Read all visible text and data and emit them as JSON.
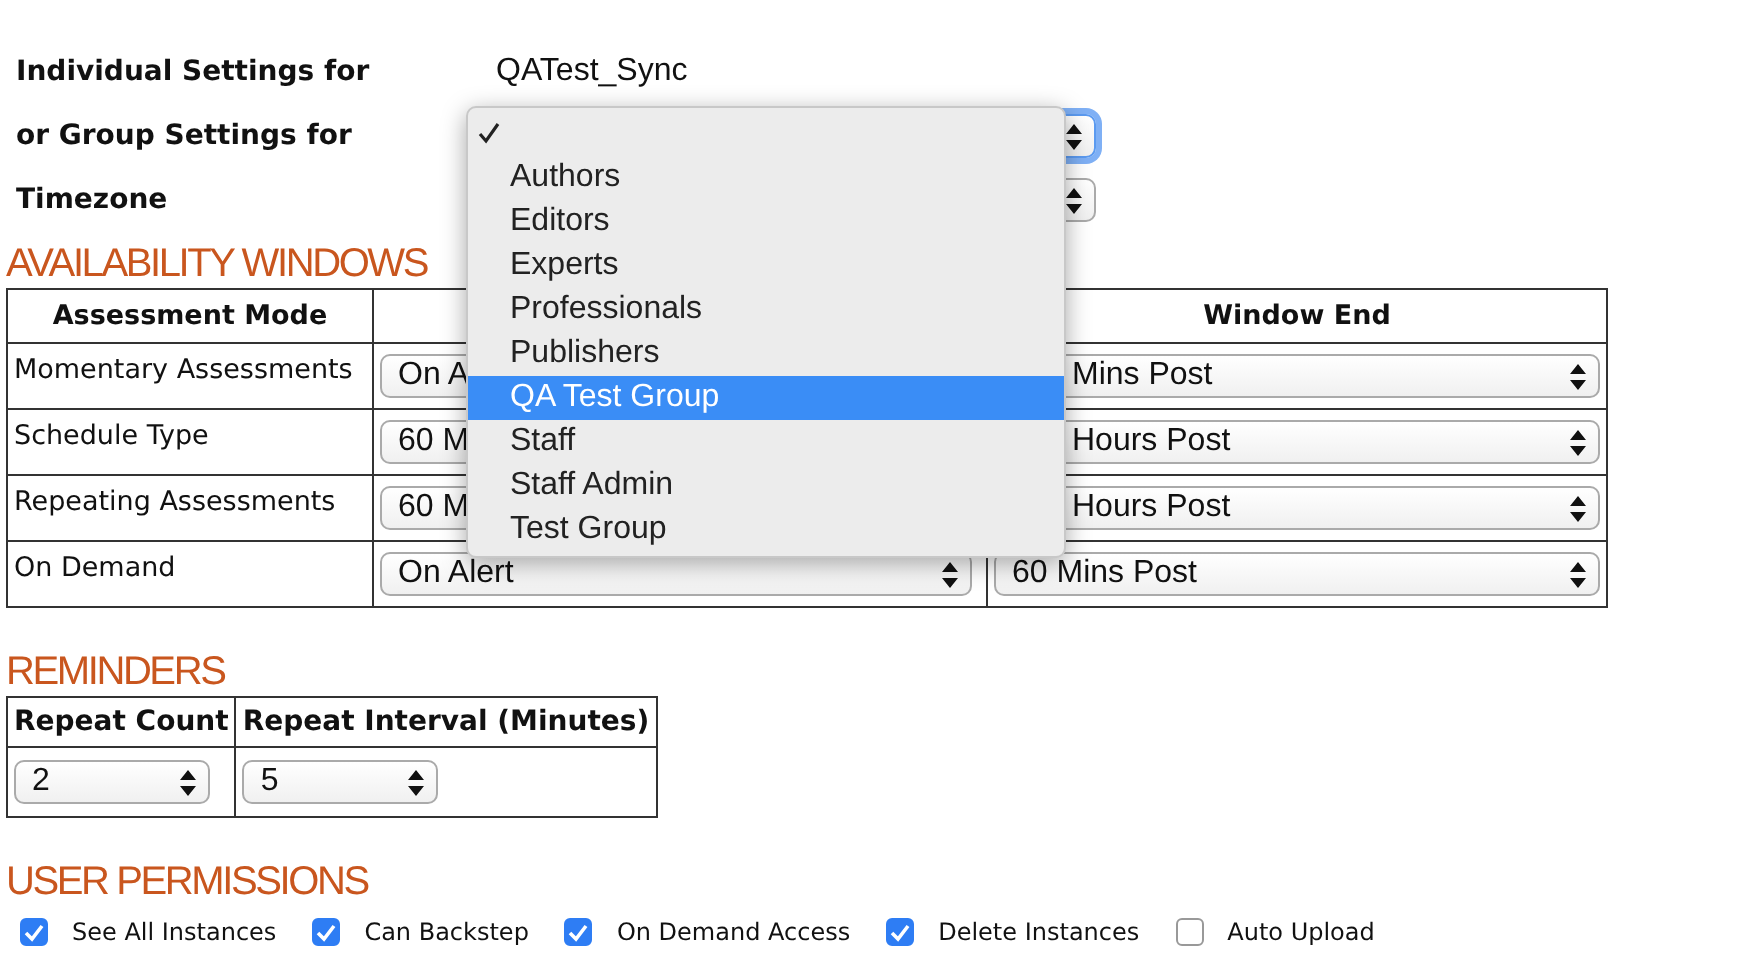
{
  "individual": {
    "label": "Individual Settings for",
    "value": "QATest_Sync"
  },
  "group": {
    "label": "or Group Settings for",
    "focused": true
  },
  "timezone": {
    "label": "Timezone",
    "focused": false
  },
  "group_menu": {
    "items": [
      {
        "checked": true,
        "selected": false
      },
      {
        "label": "Authors",
        "checked": false,
        "selected": false
      },
      {
        "label": "Editors",
        "checked": false,
        "selected": false
      },
      {
        "label": "Experts",
        "checked": false,
        "selected": false
      },
      {
        "label": "Professionals",
        "checked": false,
        "selected": false
      },
      {
        "label": "Publishers",
        "checked": false,
        "selected": false
      },
      {
        "label": "QA Test Group",
        "checked": false,
        "selected": true
      },
      {
        "label": "Staff",
        "checked": false,
        "selected": false
      },
      {
        "label": "Staff Admin",
        "checked": false,
        "selected": false
      },
      {
        "label": "Test Group",
        "checked": false,
        "selected": false
      }
    ]
  },
  "availability": {
    "title": "AVAILABILITY WINDOWS",
    "columns": {
      "column_1": "Assessment Mode",
      "column_3": "Window End"
    },
    "rows": [
      {
        "mode": "Momentary Assessments",
        "column_2": {
          "value": "On A"
        },
        "window_end": {
          "value": "Mins Post",
          "covered": true
        }
      },
      {
        "mode": "Schedule Type",
        "column_2": {
          "value": "60 M"
        },
        "window_end": {
          "value": "Hours Post",
          "covered": true
        }
      },
      {
        "mode": "Repeating Assessments",
        "column_2": {
          "value": "60 M"
        },
        "window_end": {
          "value": "Hours Post",
          "covered": true
        }
      },
      {
        "mode": "On Demand",
        "column_2": {
          "value": "On Alert"
        },
        "window_end": {
          "value": "60 Mins Post",
          "covered": false
        }
      }
    ]
  },
  "reminders": {
    "title": "REMINDERS",
    "columns": [
      "Repeat Count",
      "Repeat Interval (Minutes)"
    ],
    "values": [
      "2",
      "5"
    ]
  },
  "permissions": {
    "title": "USER PERMISSIONS",
    "items": [
      {
        "label": "See All Instances",
        "checked": true
      },
      {
        "label": "Can Backstep",
        "checked": true
      },
      {
        "label": "On Demand Access",
        "checked": true
      },
      {
        "label": "Delete Instances",
        "checked": true
      },
      {
        "label": "Auto Upload",
        "checked": false
      }
    ]
  }
}
